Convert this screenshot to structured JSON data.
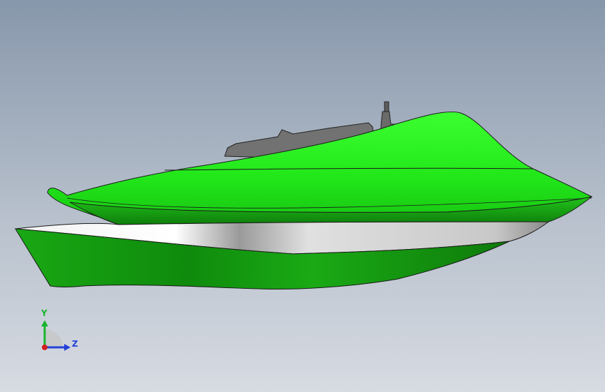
{
  "viewport": {
    "background_top": "#8797ab",
    "background_bottom": "#d7dbe2"
  },
  "model": {
    "deck_color": "#22e81a",
    "hull_color": "#1aa815",
    "chine_color": "#e4e4e4",
    "console_color": "#6f6f6f",
    "edge_color": "#1a1a1a"
  },
  "triad": {
    "y_label": "Y",
    "z_label": "Z",
    "y_color": "#17b52b",
    "z_color": "#2540d8",
    "x_color": "#d21e1e"
  }
}
